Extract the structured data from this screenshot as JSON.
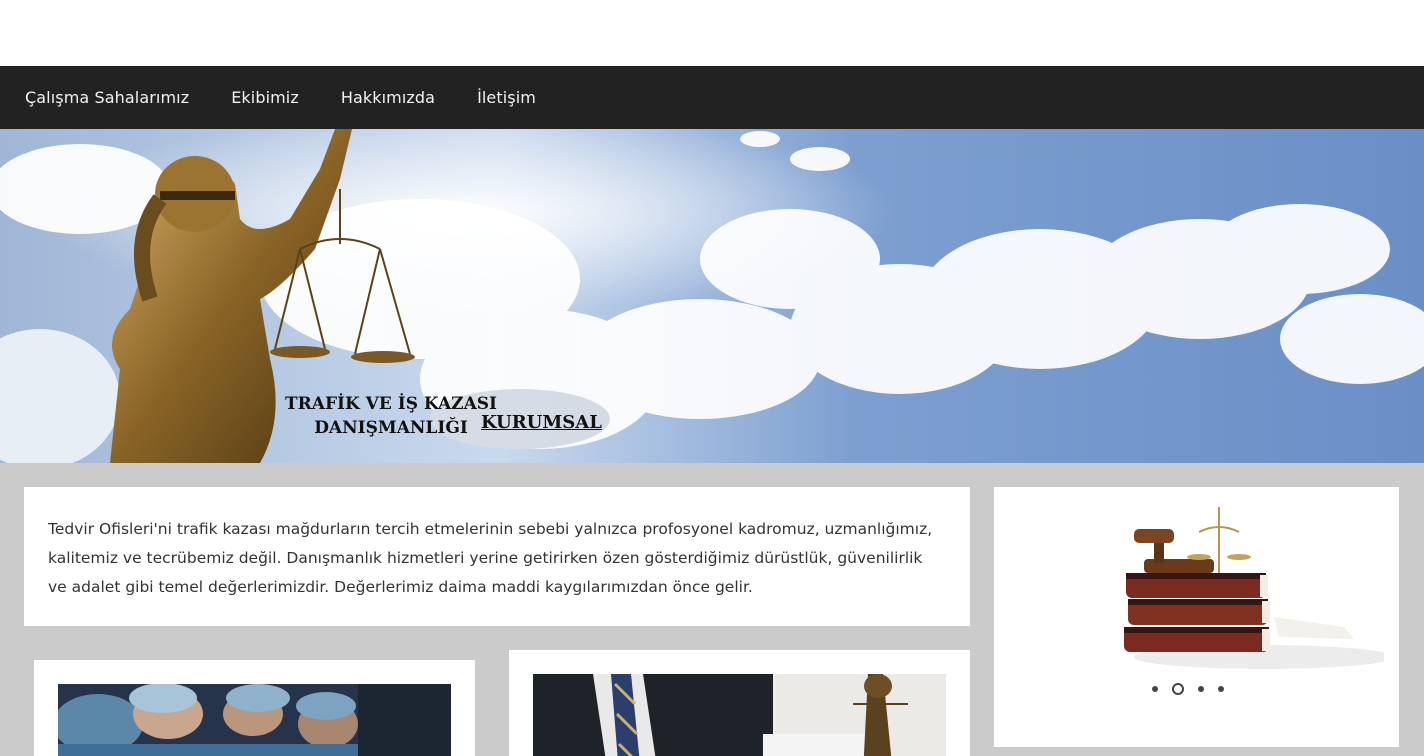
{
  "nav": {
    "items": [
      {
        "label": "Çalışma Sahalarımız"
      },
      {
        "label": "Ekibimiz"
      },
      {
        "label": "Hakkımızda"
      },
      {
        "label": "İletişim"
      }
    ]
  },
  "hero": {
    "title_line1": "TRAFİK VE İŞ KAZASI",
    "title_line2": "DANIŞMANLIĞI",
    "link_label": "KURUMSAL"
  },
  "intro": {
    "text": "Tedvir Ofisleri'ni trafik kazası mağdurların tercih etmelerinin sebebi yalnızca profosyonel kadromuz, uzmanlığımız, kalitemiz ve tecrübemiz değil. Danışmanlık hizmetleri yerine getirirken özen gösterdiğimiz dürüstlük, güvenilirlik ve adalet gibi temel değerlerimizdir. Değerlerimiz daima maddi kaygılarımızdan önce gelir."
  },
  "slider": {
    "dots": 4,
    "active_index": 1
  },
  "colors": {
    "nav_bg": "#222222",
    "content_bg": "#cbcbcb",
    "sky": "#6f93c8"
  }
}
